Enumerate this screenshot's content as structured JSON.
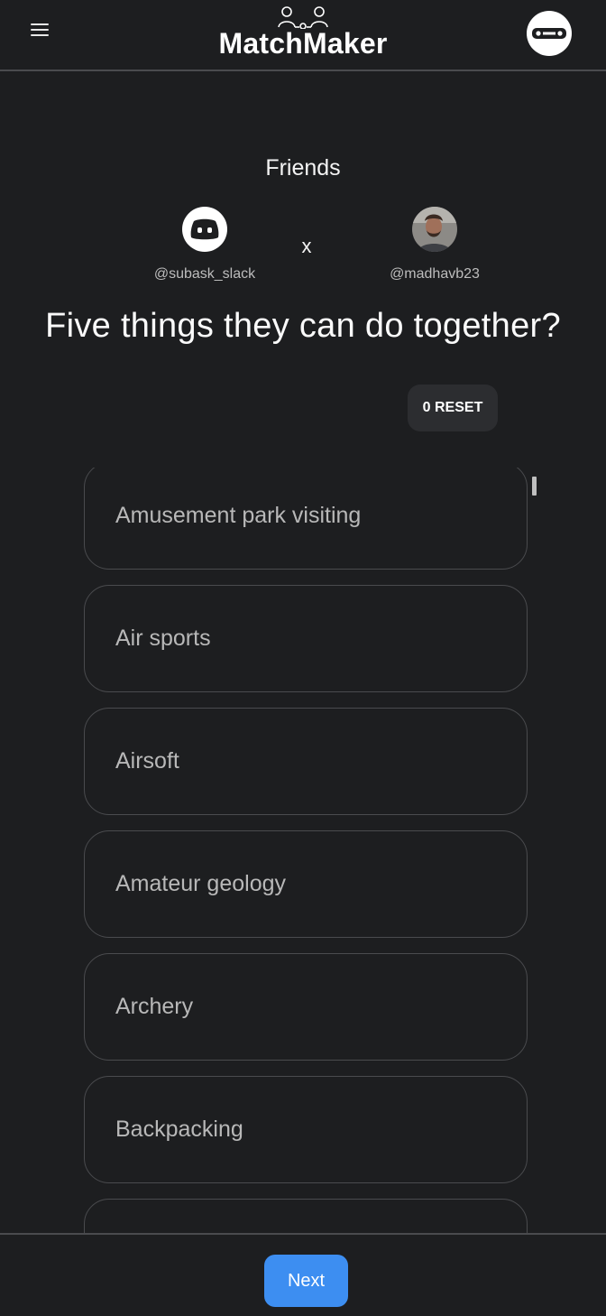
{
  "header": {
    "app_name": "MatchMaker",
    "menu_icon": "hamburger-icon",
    "logo_icon": "people-connect-icon",
    "profile_icon": "profile-avatar-icon"
  },
  "friends": {
    "title": "Friends",
    "separator": "x",
    "left_user": {
      "handle": "@subask_slack",
      "avatar_icon": "discord-icon"
    },
    "right_user": {
      "handle": "@madhavb23",
      "avatar_icon": "user-photo"
    }
  },
  "question": "Five things they can do together?",
  "reset": {
    "count": "0",
    "label": "RESET",
    "text": "0 RESET"
  },
  "options": [
    "Amusement park visiting",
    "Air sports",
    "Airsoft",
    "Amateur geology",
    "Archery",
    "Backpacking",
    ""
  ],
  "footer": {
    "next_label": "Next"
  },
  "colors": {
    "background": "#1d1e20",
    "border": "#4a4b4e",
    "accent": "#3d8ef1",
    "option_text": "#b8b8b8"
  }
}
